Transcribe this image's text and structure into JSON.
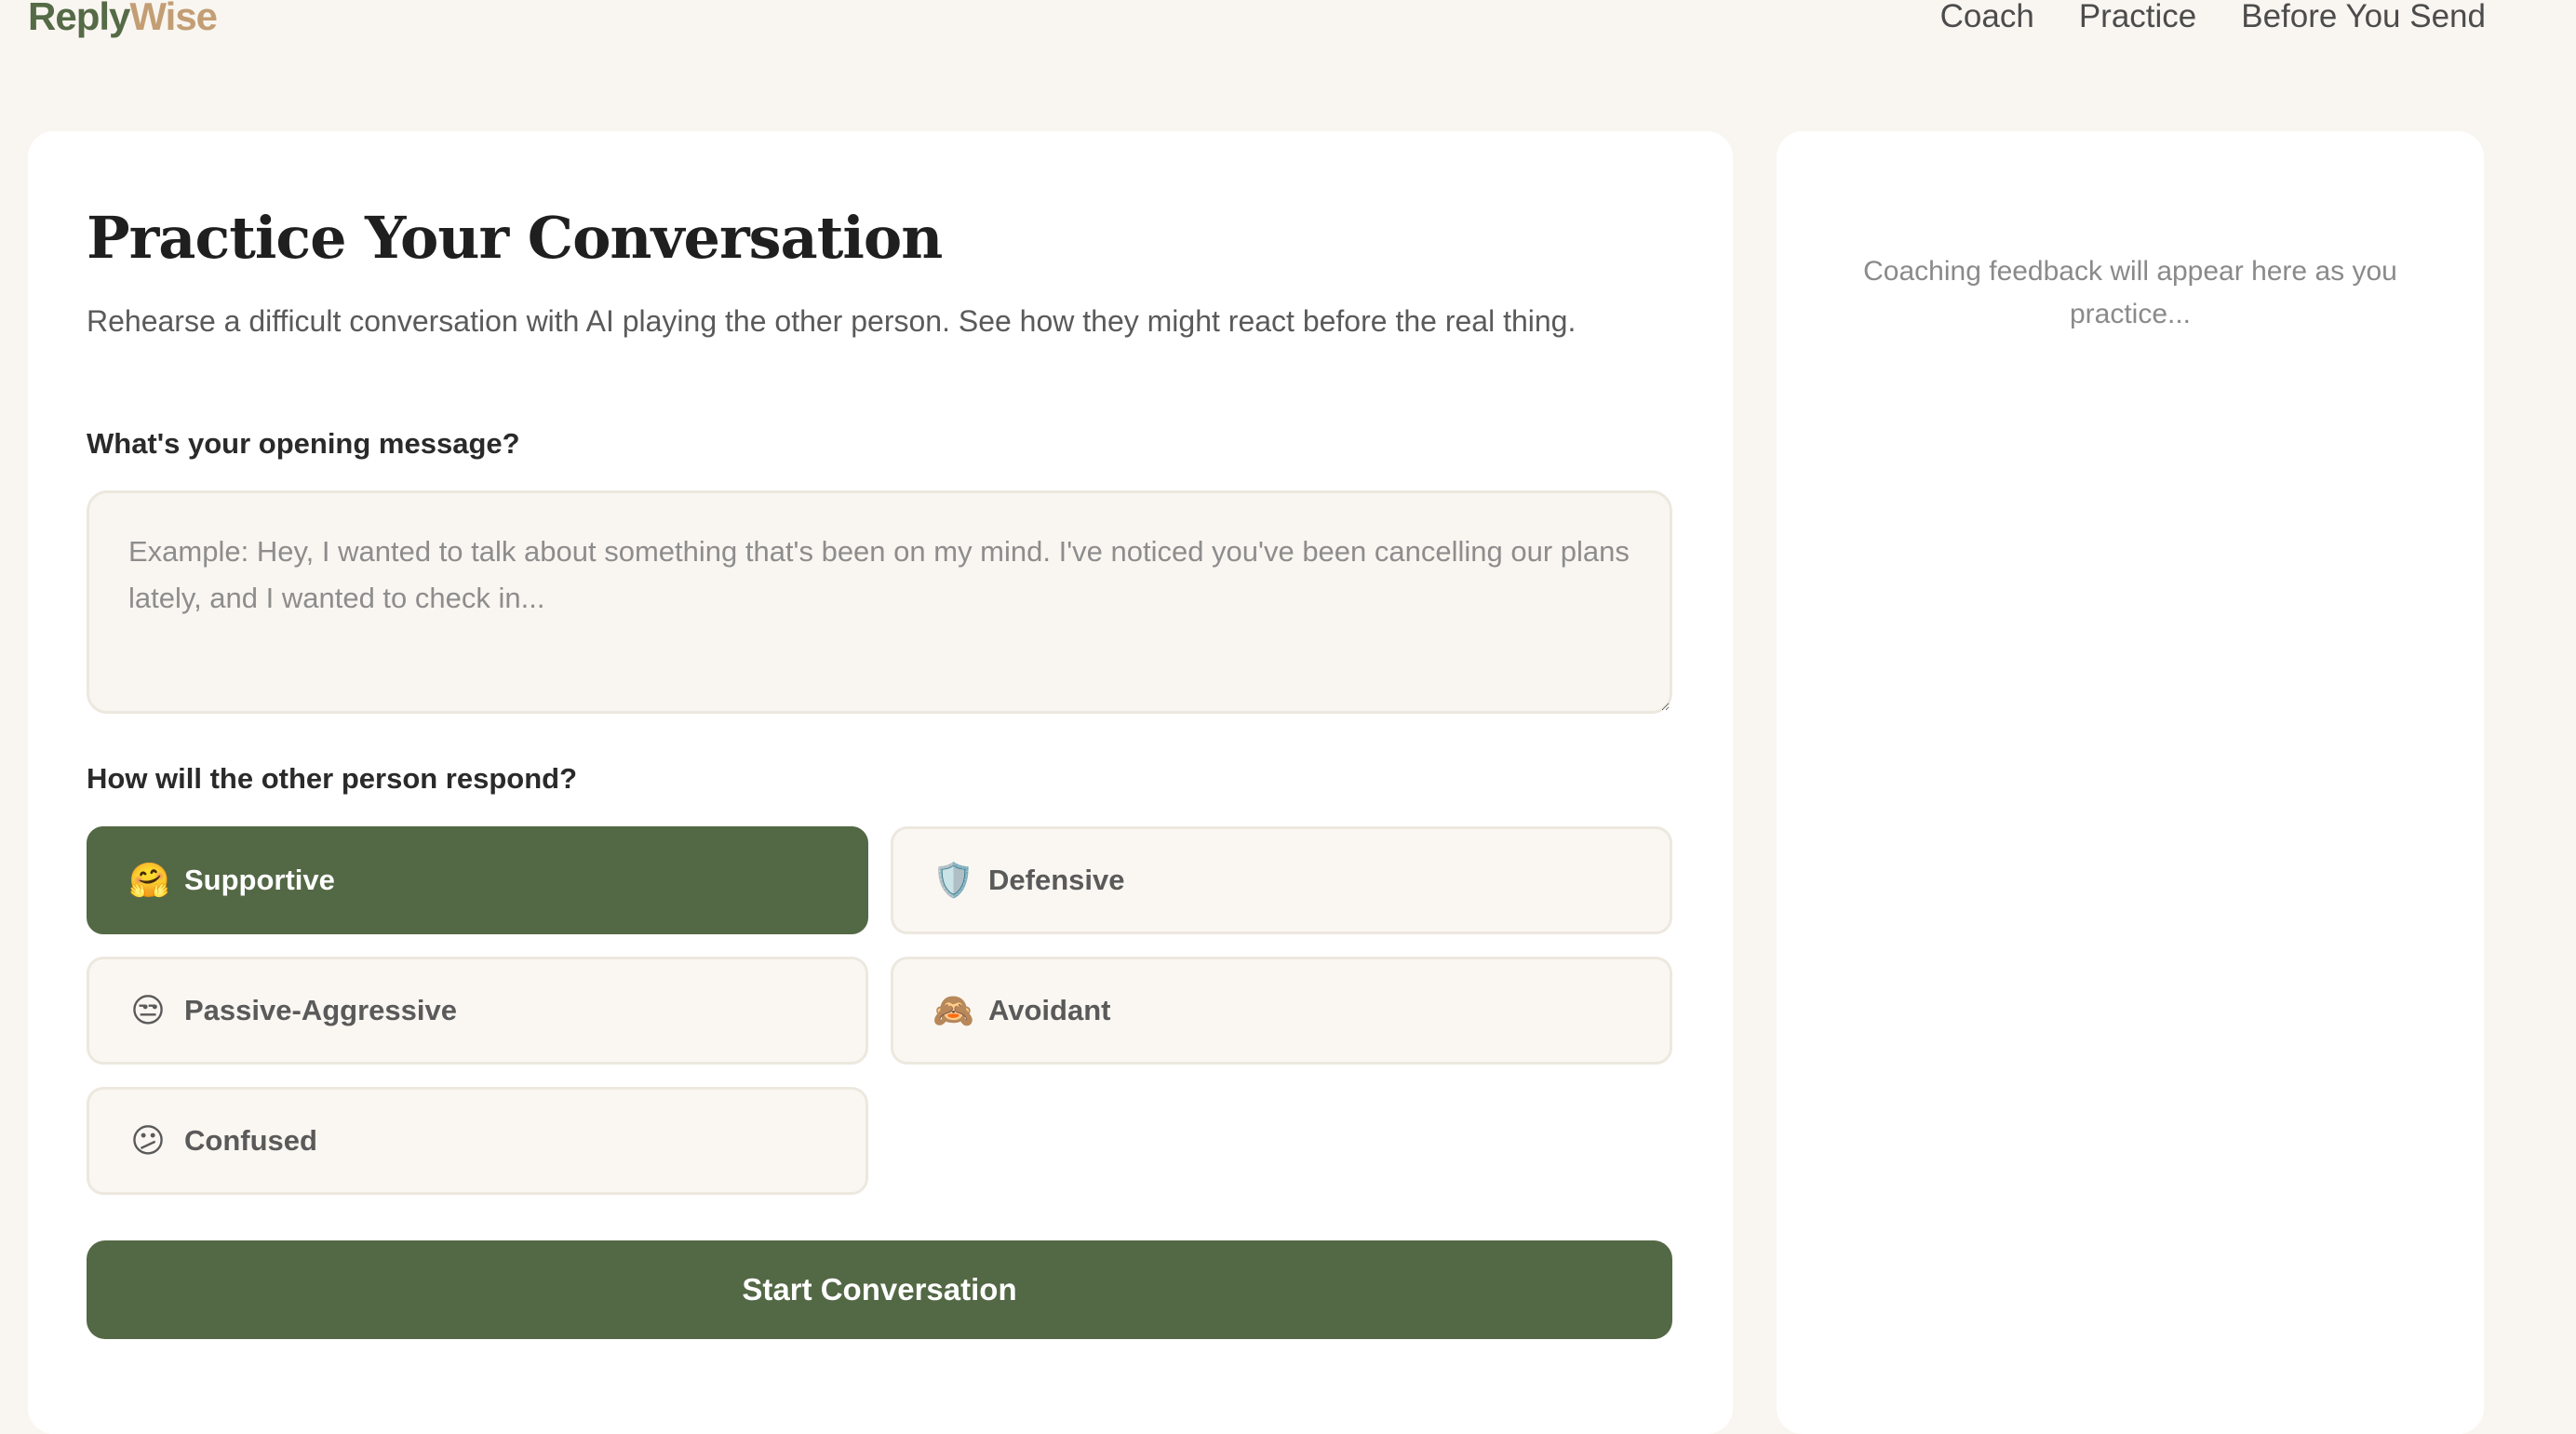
{
  "brand": {
    "part1": "Reply",
    "part2": "Wise"
  },
  "nav": {
    "items": [
      {
        "label": "Coach"
      },
      {
        "label": "Practice"
      },
      {
        "label": "Before You Send"
      }
    ]
  },
  "main": {
    "title": "Practice Your Conversation",
    "subtitle": "Rehearse a difficult conversation with AI playing the other person. See how they might react before the real thing.",
    "opening_label": "What's your opening message?",
    "opening_placeholder": "Example: Hey, I wanted to talk about something that's been on my mind. I've noticed you've been cancelling our plans lately, and I wanted to check in...",
    "opening_value": "",
    "response_label": "How will the other person respond?",
    "responses": [
      {
        "emoji": "🤗",
        "icon": "hugging-face-icon",
        "label": "Supportive",
        "selected": true
      },
      {
        "emoji": "🛡️",
        "icon": "shield-icon",
        "label": "Defensive",
        "selected": false
      },
      {
        "emoji": "😒",
        "icon": "unamused-face-icon",
        "label": "Passive-Aggressive",
        "selected": false
      },
      {
        "emoji": "🙈",
        "icon": "see-no-evil-monkey-icon",
        "label": "Avoidant",
        "selected": false
      },
      {
        "emoji": "😕",
        "icon": "confused-face-icon",
        "label": "Confused",
        "selected": false
      }
    ],
    "start_label": "Start Conversation"
  },
  "sidebar": {
    "placeholder": "Coaching feedback will appear here as you practice..."
  },
  "colors": {
    "accent": "#536845",
    "brand_primary": "#556a46",
    "brand_secondary": "#c39e74",
    "background": "#f9f6f1"
  }
}
